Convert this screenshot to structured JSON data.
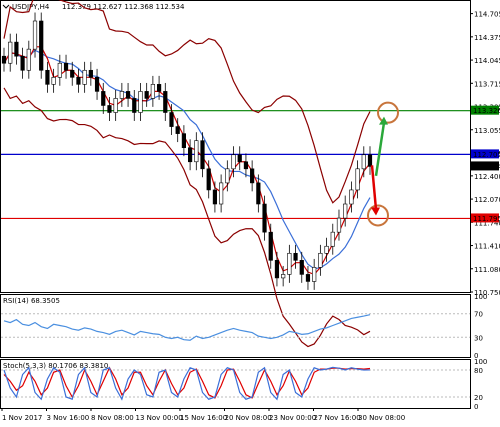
{
  "header": {
    "symbol": "USDJPY,H4",
    "ohlc": "112.379 112.627 112.368 112.534"
  },
  "colors": {
    "bull": "#000000",
    "bear": "#000000",
    "bb": "#8b0000",
    "ma_fast": "#cc0000",
    "ma_slow": "#3b6fd8",
    "green_line": "#008000",
    "blue_line": "#0000cc",
    "red_line": "#e00000",
    "rsi": "#4a8fe0",
    "stoch_main": "#3b6fd8",
    "stoch_signal": "#e00000",
    "circle": "#c8753c",
    "green_arrow": "#2aa83a",
    "red_arrow": "#e00000"
  },
  "levels": {
    "green": {
      "value": 113.326,
      "label": "113.326"
    },
    "blue": {
      "value": 112.705,
      "label": "112.705"
    },
    "current": {
      "value": 112.534,
      "label": "112.534"
    },
    "red": {
      "value": 111.795,
      "label": "111.795"
    }
  },
  "rsi_panel": {
    "label": "RSI(14) 68.3505",
    "ticks": [
      "100",
      "70",
      "30",
      "0"
    ]
  },
  "stoch_panel": {
    "label": "Stoch(5,3,3) 80.1706 83.3810",
    "ticks": [
      "100",
      "80",
      "20",
      "0"
    ]
  },
  "chart_data": {
    "type": "line",
    "title": "USDJPY,H4",
    "price_ticks": [
      "114.705",
      "114.375",
      "114.045",
      "113.715",
      "113.385",
      "113.055",
      "112.725",
      "112.400",
      "112.070",
      "111.740",
      "111.410",
      "111.080",
      "110.750"
    ],
    "ylim": [
      110.75,
      114.87
    ],
    "time_ticks": [
      "1 Nov 2017",
      "3 Nov 16:00",
      "8 Nov 08:00",
      "13 Nov 00:00",
      "15 Nov 16:00",
      "20 Nov 08:00",
      "23 Nov 00:00",
      "27 Nov 16:00",
      "30 Nov 08:00"
    ],
    "close": [
      114.0,
      114.3,
      114.1,
      113.9,
      114.2,
      114.6,
      113.9,
      113.7,
      113.8,
      114.0,
      113.9,
      113.8,
      113.7,
      113.9,
      113.8,
      113.6,
      113.4,
      113.3,
      113.5,
      113.6,
      113.5,
      113.3,
      113.6,
      113.5,
      113.7,
      113.6,
      113.3,
      113.1,
      113.0,
      112.8,
      112.6,
      112.9,
      112.5,
      112.2,
      112.0,
      112.3,
      112.5,
      112.7,
      112.6,
      112.5,
      112.3,
      112.0,
      111.6,
      111.2,
      110.95,
      111.0,
      111.3,
      111.2,
      111.0,
      110.9,
      111.1,
      111.3,
      111.4,
      111.6,
      111.8,
      112.0,
      112.2,
      112.5,
      112.7,
      112.534
    ],
    "rsi": [
      58,
      55,
      60,
      52,
      50,
      55,
      48,
      45,
      52,
      50,
      48,
      44,
      42,
      46,
      44,
      40,
      38,
      35,
      40,
      42,
      38,
      34,
      40,
      38,
      36,
      35,
      30,
      28,
      30,
      26,
      25,
      32,
      28,
      30,
      34,
      38,
      42,
      45,
      42,
      40,
      38,
      32,
      30,
      28,
      30,
      34,
      40,
      38,
      35,
      36,
      40,
      44,
      46,
      50,
      54,
      58,
      62,
      64,
      66,
      68.35
    ],
    "stoch_main": [
      80,
      40,
      20,
      70,
      85,
      30,
      15,
      60,
      85,
      75,
      20,
      15,
      70,
      85,
      30,
      20,
      80,
      85,
      40,
      15,
      60,
      80,
      70,
      25,
      20,
      75,
      80,
      30,
      20,
      60,
      85,
      80,
      30,
      15,
      20,
      70,
      85,
      80,
      30,
      15,
      20,
      75,
      85,
      30,
      15,
      70,
      80,
      30,
      20,
      60,
      85,
      80,
      82,
      86,
      84,
      80,
      85,
      82,
      80,
      80.17
    ],
    "stoch_signal": [
      70,
      55,
      35,
      45,
      75,
      55,
      25,
      40,
      75,
      80,
      45,
      20,
      45,
      80,
      55,
      25,
      55,
      85,
      60,
      25,
      40,
      75,
      75,
      45,
      25,
      55,
      80,
      50,
      25,
      40,
      75,
      82,
      55,
      25,
      18,
      45,
      80,
      82,
      55,
      25,
      18,
      50,
      80,
      55,
      25,
      45,
      78,
      55,
      25,
      40,
      75,
      82,
      82,
      84,
      84,
      82,
      83,
      83,
      82,
      83.38
    ]
  }
}
